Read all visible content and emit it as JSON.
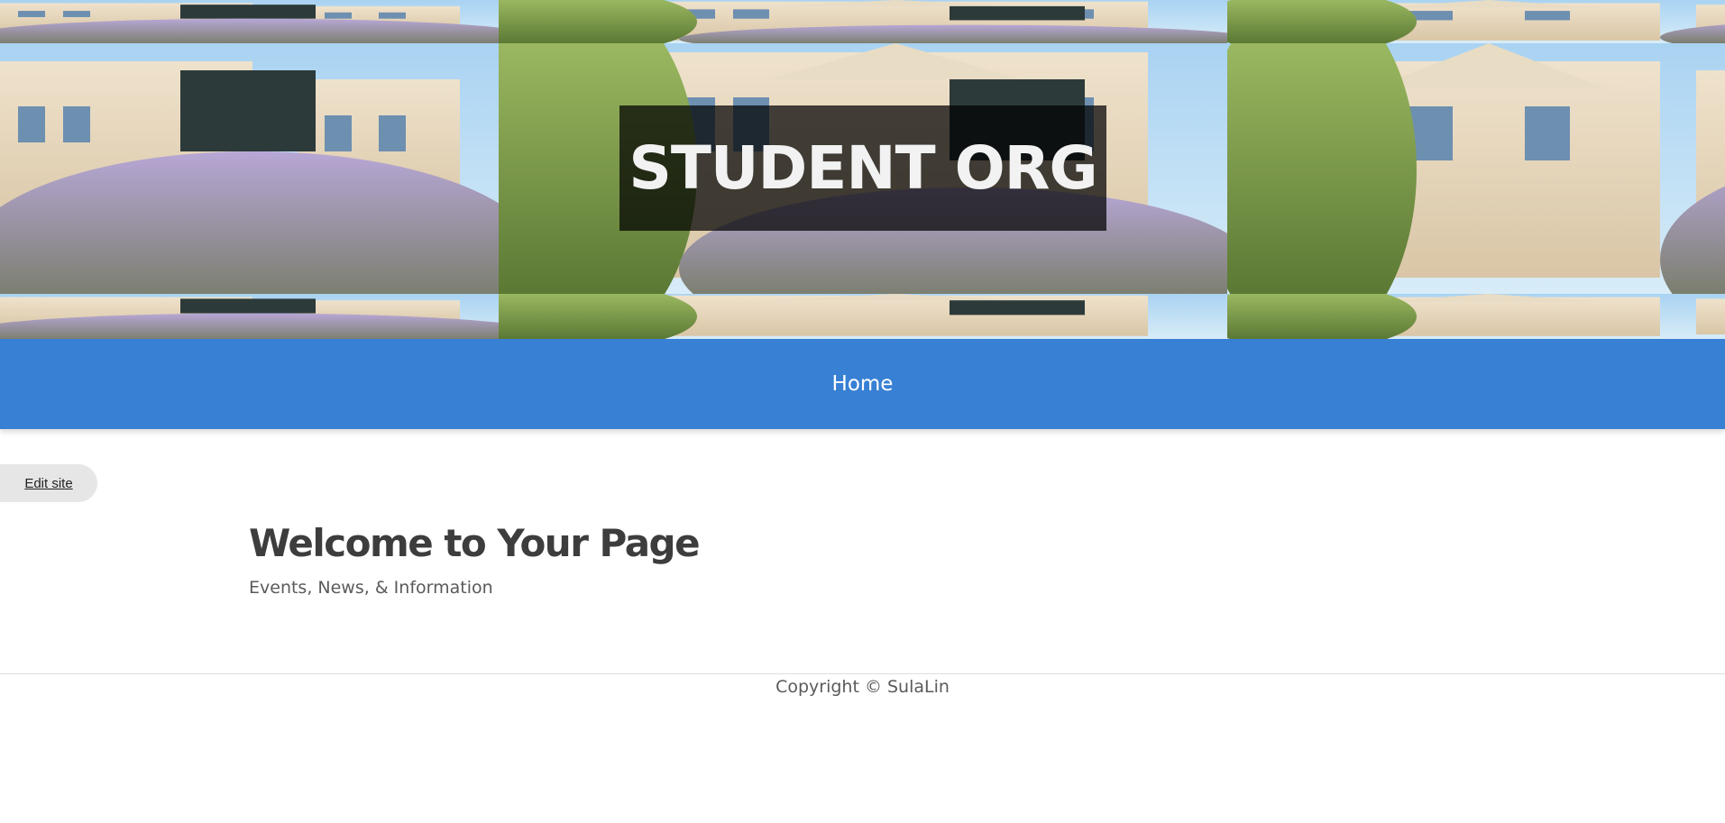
{
  "header": {
    "site_title": "STUDENT ORG",
    "banner_image": "campus-building-lilacs-photo"
  },
  "nav": {
    "items": [
      {
        "label": "Home"
      }
    ],
    "background": "#3880d4"
  },
  "edit_site": {
    "label": "Edit site"
  },
  "main": {
    "title": "Welcome to Your Page",
    "subtitle": "Events, News, & Information"
  },
  "footer": {
    "copyright": "Copyright © SulaLin"
  },
  "colors": {
    "nav_blue": "#3880d4",
    "title_overlay": "#000000",
    "heading_text": "#3d3d3d",
    "body_text": "#5a5a5a"
  }
}
